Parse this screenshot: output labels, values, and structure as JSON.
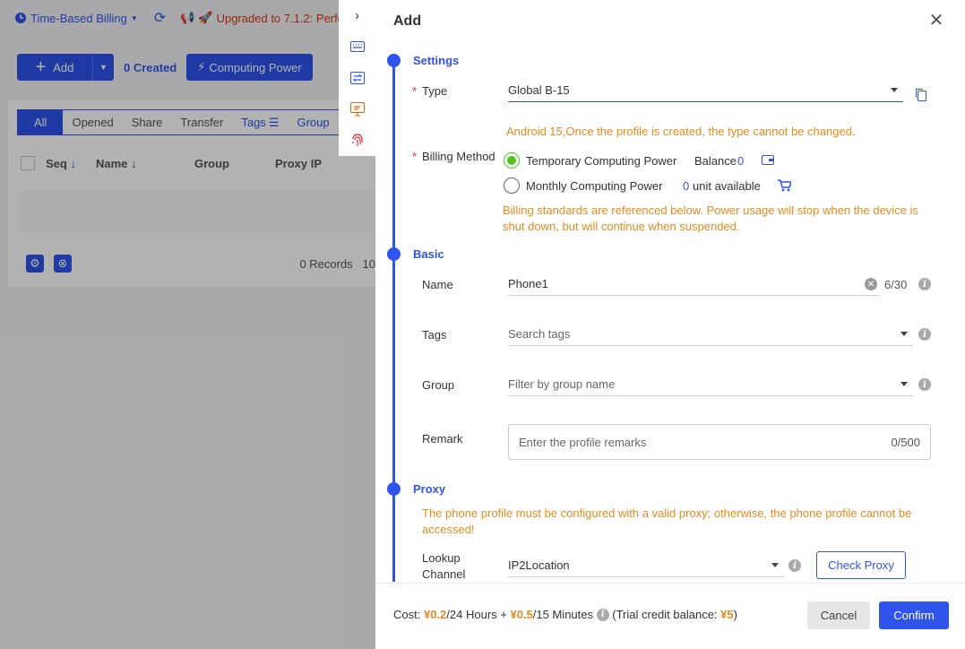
{
  "background": {
    "billing_mode": "Time-Based Billing",
    "upgrade_notice": "Upgraded to 7.1.2: Perfo",
    "add_label": "Add",
    "created_count": "0 Created",
    "computing_power_label": "Computing Power",
    "tabs": [
      {
        "label": "All",
        "active": true
      },
      {
        "label": "Opened"
      },
      {
        "label": "Share"
      },
      {
        "label": "Transfer"
      },
      {
        "label": "Tags"
      },
      {
        "label": "Group"
      }
    ],
    "columns": [
      "Seq",
      "Name",
      "Group",
      "Proxy IP"
    ],
    "records": "0 Records",
    "page_size_partial": "10"
  },
  "drawer": {
    "title": "Add",
    "sections": {
      "settings": "Settings",
      "basic": "Basic",
      "proxy": "Proxy"
    },
    "type": {
      "label": "Type",
      "value": "Global B-15",
      "warning": "Android 15,Once the profile is created, the type cannot be changed."
    },
    "billing": {
      "label": "Billing Method",
      "option_temp": "Temporary Computing Power",
      "balance_label": "Balance",
      "balance_value": "0",
      "option_monthly": "Monthly Computing Power",
      "units_value": "0",
      "units_label": "unit available",
      "selected": "temporary",
      "warning": "Billing standards are referenced below. Power usage will stop when the device is shut down, but will continue when suspended."
    },
    "name": {
      "label": "Name",
      "value": "Phone1",
      "counter": "6/30"
    },
    "tags": {
      "label": "Tags",
      "placeholder": "Search tags"
    },
    "group": {
      "label": "Group",
      "placeholder": "Filter by group name"
    },
    "remark": {
      "label": "Remark",
      "placeholder": "Enter the profile remarks",
      "counter": "0/500"
    },
    "proxy": {
      "warning": "The phone profile must be configured with a valid proxy; otherwise, the phone profile cannot be accessed!",
      "lookup_label_1": "Lookup",
      "lookup_label_2": "Channel",
      "lookup_value": "IP2Location",
      "check_label": "Check Proxy"
    },
    "footer": {
      "cost_prefix": "Cost:",
      "price_day": "¥0.2",
      "per_day": "/24 Hours +",
      "price_quarter": "¥0.5",
      "per_quarter": "/15 Minutes",
      "trial_prefix": "(Trial credit balance:",
      "trial_value": "¥5",
      "trial_suffix": ")",
      "cancel_label": "Cancel",
      "confirm_label": "Confirm"
    }
  },
  "colors": {
    "primary": "#2f54eb",
    "warning": "#e58a1f",
    "radio_selected": "#52c41a",
    "danger": "#d4380d"
  }
}
